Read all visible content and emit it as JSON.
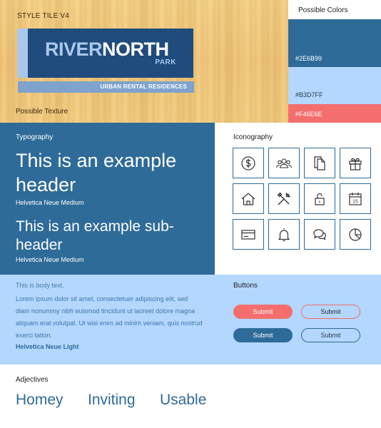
{
  "tile": {
    "title": "STYLE TILE V4",
    "texture_label": "Possible Texture"
  },
  "logo": {
    "river": "RIVER",
    "north": "NORTH",
    "park": "PARK",
    "tagline": "URBAN RENTAL RESIDENCES"
  },
  "colors": {
    "title": "Possible Colors",
    "swatches": [
      {
        "hex": "#2E6B99",
        "value": "#2e6b99"
      },
      {
        "hex": "#B3D7FF",
        "value": "#b3d7ff"
      },
      {
        "hex": "#F46E6E",
        "value": "#f46e6e"
      }
    ]
  },
  "typography": {
    "label": "Typography",
    "header": "This is an example header",
    "header_font": "Helvetica Neue Medium",
    "subheader": "This is an example sub-header",
    "subheader_font": "Helvetica Neue Medium"
  },
  "iconography": {
    "label": "Iconography",
    "icons": [
      "dollar-icon",
      "users-icon",
      "documents-icon",
      "gift-icon",
      "home-icon",
      "tools-icon",
      "unlock-icon",
      "calendar-icon",
      "credit-card-icon",
      "bell-icon",
      "chat-icon",
      "pie-chart-icon"
    ],
    "calendar_day": "15"
  },
  "body": {
    "intro": "This is body text.",
    "lorem": "Lorem ipsum dolor sit amet, consectetuer adipiscing elit, sed diam nonummy nibh euismod tincidunt ut laoreet dolore magna aliquam erat volutpat. Ut wisi enim ad minim veniam, quis nostrud exerci tation.",
    "font": "Helvetica Neue Light"
  },
  "buttons": {
    "label": "Buttons",
    "coral_solid": "Submit",
    "coral_outline": "Submit",
    "blue_solid": "Submit",
    "blue_outline": "Submit"
  },
  "adjectives": {
    "label": "Adjectives",
    "words": [
      "Homey",
      "Inviting",
      "Usable"
    ]
  }
}
